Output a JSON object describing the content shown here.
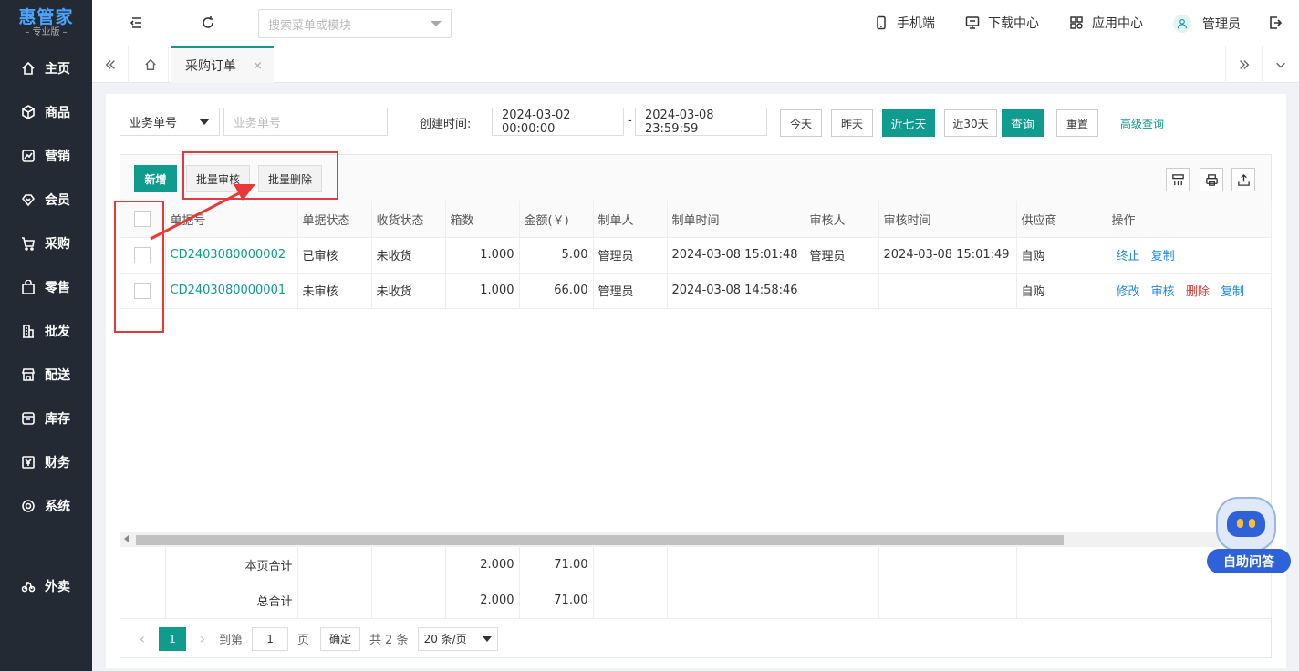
{
  "app": {
    "logo_main": "惠管家",
    "logo_sub": "– 专业版 –",
    "nav": [
      {
        "label": "主页",
        "icon": "home-icon"
      },
      {
        "label": "商品",
        "icon": "box-icon"
      },
      {
        "label": "营销",
        "icon": "chart-icon"
      },
      {
        "label": "会员",
        "icon": "member-icon"
      },
      {
        "label": "采购",
        "icon": "cart-icon"
      },
      {
        "label": "零售",
        "icon": "bag-icon"
      },
      {
        "label": "批发",
        "icon": "building-icon"
      },
      {
        "label": "配送",
        "icon": "store-icon"
      },
      {
        "label": "库存",
        "icon": "inventory-icon"
      },
      {
        "label": "财务",
        "icon": "yen-icon"
      },
      {
        "label": "系统",
        "icon": "settings-icon"
      },
      {
        "label": "外卖",
        "icon": "bike-icon"
      }
    ]
  },
  "topbar": {
    "search_placeholder": "搜索菜单或模块",
    "mobile": "手机端",
    "download": "下载中心",
    "apps": "应用中心",
    "user": "管理员"
  },
  "tabs": {
    "active": "采购订单",
    "close": "×"
  },
  "filters": {
    "field_select": "业务单号",
    "field_placeholder": "业务单号",
    "created_label": "创建时间:",
    "date_from": "2024-03-02 00:00:00",
    "date_sep": "-",
    "date_to": "2024-03-08 23:59:59",
    "today": "今天",
    "yesterday": "昨天",
    "last7": "近七天",
    "last30": "近30天",
    "query": "查询",
    "reset": "重置",
    "advanced": "高级查询"
  },
  "toolbar": {
    "add": "新增",
    "batch_approve": "批量审核",
    "batch_delete": "批量删除"
  },
  "table": {
    "headers": [
      "单据号",
      "单据状态",
      "收货状态",
      "箱数",
      "金额(￥)",
      "制单人",
      "制单时间",
      "审核人",
      "审核时间",
      "供应商",
      "操作"
    ],
    "rows": [
      {
        "order_no": "CD2403080000002",
        "status": "已审核",
        "receive": "未收货",
        "boxes": "1.000",
        "amount": "5.00",
        "creator": "管理员",
        "created_at": "2024-03-08 15:01:48",
        "approver": "管理员",
        "approved_at": "2024-03-08 15:01:49",
        "supplier": "自购",
        "ops": [
          "终止",
          "复制"
        ]
      },
      {
        "order_no": "CD2403080000001",
        "status": "未审核",
        "receive": "未收货",
        "boxes": "1.000",
        "amount": "66.00",
        "creator": "管理员",
        "created_at": "2024-03-08 14:58:46",
        "approver": "",
        "approved_at": "",
        "supplier": "自购",
        "ops": [
          "修改",
          "审核",
          "删除",
          "复制"
        ]
      }
    ],
    "page_total_label": "本页合计",
    "page_total_boxes": "2.000",
    "page_total_amount": "71.00",
    "grand_total_label": "总合计",
    "grand_total_boxes": "2.000",
    "grand_total_amount": "71.00"
  },
  "pager": {
    "current": "1",
    "goto_label": "到第",
    "goto_value": "1",
    "page_unit": "页",
    "confirm": "确定",
    "total": "共 2 条",
    "page_size": "20 条/页"
  },
  "assistant": {
    "label": "自助问答"
  },
  "colors": {
    "accent": "#0f9b8e",
    "sidebar": "#232a33",
    "highlight": "#e8393a",
    "link_blue": "#1e88e5",
    "danger": "#e53935"
  }
}
